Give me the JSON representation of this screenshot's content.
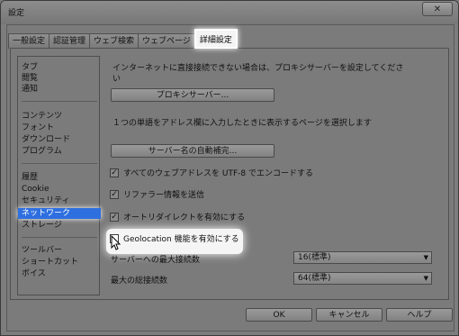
{
  "window": {
    "title": "設定",
    "close_label": "✕"
  },
  "tabs": [
    {
      "label": "一般設定",
      "active": false
    },
    {
      "label": "認証管理",
      "active": false
    },
    {
      "label": "ウェブ検索",
      "active": false
    },
    {
      "label": "ウェブページ",
      "active": false
    },
    {
      "label": "詳細設定",
      "active": true
    }
  ],
  "sidebar": {
    "groups": [
      [
        "タブ",
        "閲覧",
        "通知"
      ],
      [
        "コンテンツ",
        "フォント",
        "ダウンロード",
        "プログラム"
      ],
      [
        "履歴",
        "Cookie",
        "セキュリティ",
        "ネットワーク",
        "ストレージ"
      ],
      [
        "ツールバー",
        "ショートカット",
        "ボイス"
      ]
    ],
    "selected": "ネットワーク"
  },
  "main": {
    "proxy_text_line1": "インターネットに直接接続できない場合は、プロキシサーバーを設定してくださ",
    "proxy_text_line2": "い",
    "proxy_button": "プロキシサーバー...",
    "single_word_text": "１つの単語をアドレス欄に入力したときに表示するページを選択します",
    "server_name_button": "サーバー名の自動補完...",
    "checkboxes": [
      {
        "label": "すべてのウェブアドレスを UTF-8 でエンコードする",
        "checked": true
      },
      {
        "label": "リファラー情報を送信",
        "checked": true
      },
      {
        "label": "オートリダイレクトを有効にする",
        "checked": true
      },
      {
        "label": "Geolocation 機能を有効にする",
        "checked": false
      }
    ],
    "max_server_connections_label": "サーバーへの最大接続数",
    "max_server_connections_value": "16(標準)",
    "max_total_connections_label": "最大の総接続数",
    "max_total_connections_value": "64(標準)"
  },
  "footer": {
    "ok": "OK",
    "cancel": "キャンセル",
    "help": "ヘルプ"
  }
}
